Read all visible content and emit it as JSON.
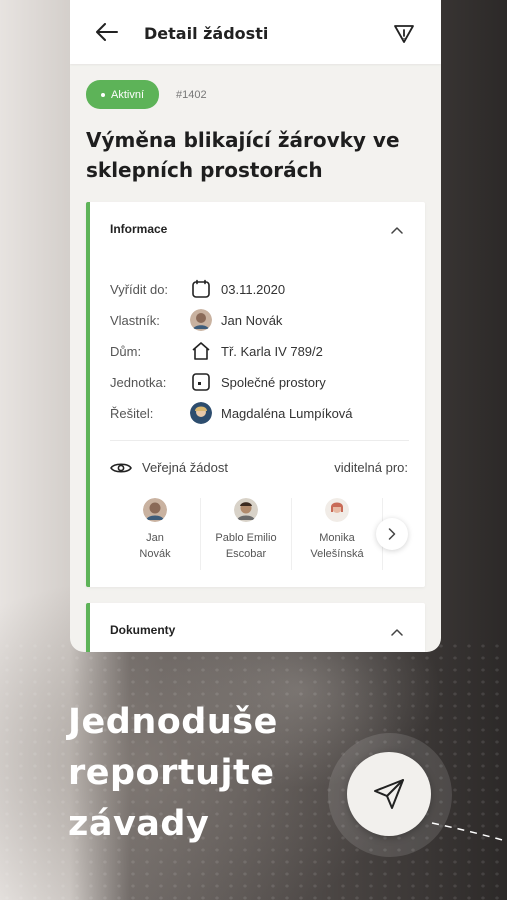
{
  "appbar": {
    "title": "Detail žádosti",
    "back_icon": "arrow-left-icon",
    "filter_icon": "warning-triangle-icon"
  },
  "request": {
    "status": "Aktivní",
    "status_color": "#5db358",
    "number": "#1402",
    "title": "Výměna blikající žárovky ve sklepních prostorách"
  },
  "info": {
    "header": "Informace",
    "rows": [
      {
        "label": "Vyřídit do:",
        "value": "03.11.2020",
        "icon": "calendar-icon"
      },
      {
        "label": "Vlastník:",
        "value": "Jan Novák",
        "icon": "avatar"
      },
      {
        "label": "Dům:",
        "value": "Tř. Karla IV 789/2",
        "icon": "house-icon"
      },
      {
        "label": "Jednotka:",
        "value": "Společné prostory",
        "icon": "unit-icon"
      },
      {
        "label": "Řešitel:",
        "value": "Magdaléna Lumpíková",
        "icon": "avatar"
      }
    ],
    "public_label": "Veřejná žádost",
    "visible_for": "viditelná pro:",
    "people": [
      {
        "name": "Jan\nNovák"
      },
      {
        "name": "Pablo Emilio\nEscobar"
      },
      {
        "name": "Monika\nVelešínská"
      }
    ]
  },
  "documents": {
    "header": "Dokumenty"
  },
  "promo": {
    "tagline": "Jednoduše\nreportujte\nzávady",
    "fab_icon": "send-icon"
  }
}
